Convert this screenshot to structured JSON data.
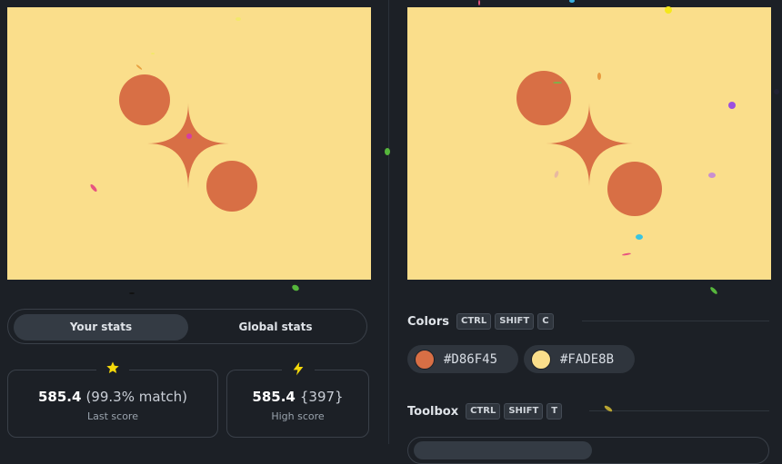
{
  "canvases": {
    "left": {
      "background": "#FADE8B",
      "shape_color": "#D86F45"
    },
    "right": {
      "background": "#FADE8B",
      "shape_color": "#D86F45"
    }
  },
  "stats": {
    "tabs": [
      "Your stats",
      "Global stats"
    ],
    "active_tab": "Your stats",
    "last_score": {
      "value": "585.4",
      "detail": "(99.3% match)",
      "caption": "Last score",
      "icon": "star-icon",
      "icon_color": "#F5D90A"
    },
    "high_score": {
      "value": "585.4",
      "detail": "{397}",
      "caption": "High score",
      "icon": "lightning-icon",
      "icon_color": "#F5D90A"
    }
  },
  "colors_section": {
    "title": "Colors",
    "shortcut": [
      "CTRL",
      "SHIFT",
      "C"
    ],
    "swatches": [
      {
        "hex": "#D86F45"
      },
      {
        "hex": "#FADE8B"
      }
    ]
  },
  "toolbox_section": {
    "title": "Toolbox",
    "shortcut": [
      "CTRL",
      "SHIFT",
      "T"
    ]
  }
}
